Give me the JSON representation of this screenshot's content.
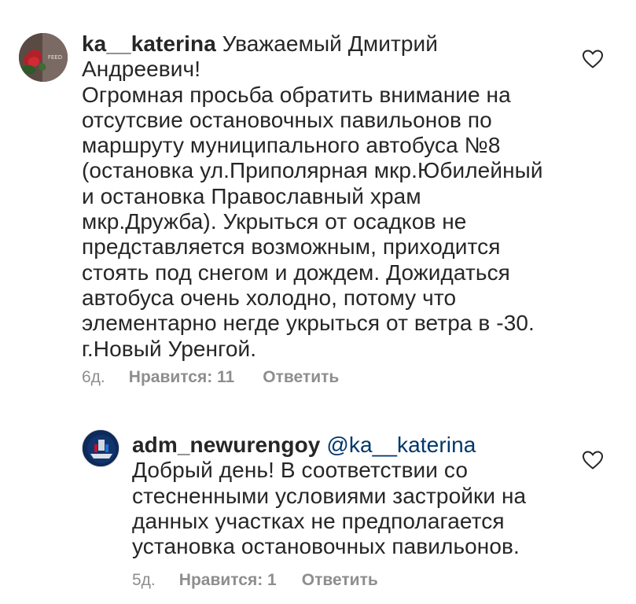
{
  "comments": [
    {
      "username": "ka__katerina",
      "text": "Уважаемый Дмитрий Андреевич!",
      "text_more": "Огромная просьба обратить внимание на отсутсвие остановочных павильонов по маршруту муниципального автобуса №8 (остановка ул.Приполярная мкр.Юбилейный и остановка Православный храм мкр.Дружба). Укрыться от осадков не представляется возможным, приходится стоять под снегом и дождем. Дожидаться автобуса очень холодно, потому что элементарно негде укрыться от ветра в -30. г.Новый Уренгой.",
      "time": "6д.",
      "likes": "Нравится: 11",
      "reply": "Ответить",
      "avatar_text": "FEED"
    },
    {
      "username": "adm_newurengoy",
      "mention": "@ka__katerina",
      "text": "Добрый день! В соответствии со стесненными условиями застройки на данных участках не предполагается установка остановочных павильонов.",
      "time": "5д.",
      "likes": "Нравится: 1",
      "reply": "Ответить"
    }
  ],
  "colors": {
    "text": "#262626",
    "meta": "#8e8e8e",
    "mention": "#00376b",
    "avatar_bg_1": "#6b5a52",
    "avatar_bg_2": "#0d2a5a"
  },
  "icons": [
    "heart-icon"
  ]
}
